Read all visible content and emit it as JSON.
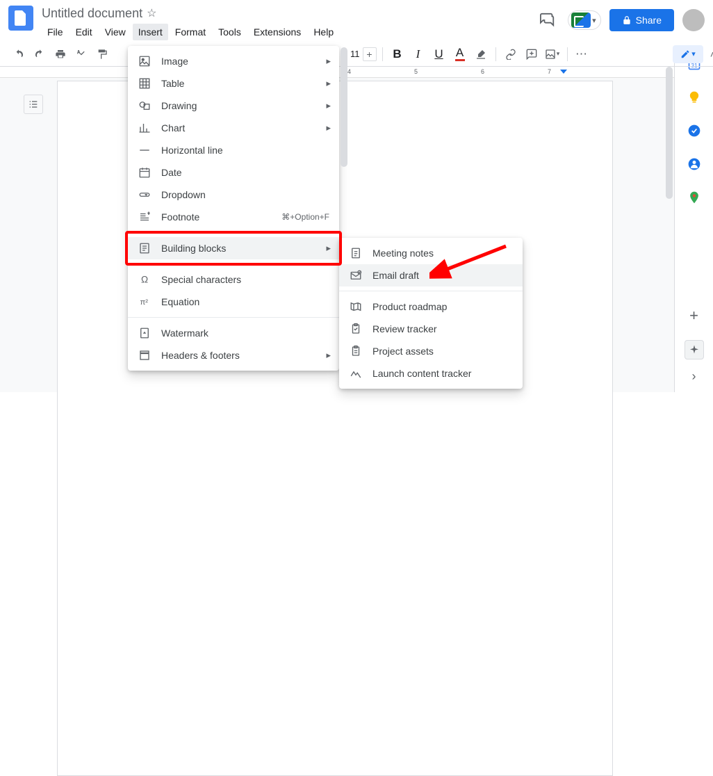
{
  "doc_title": "Untitled document",
  "menubar": [
    "File",
    "Edit",
    "View",
    "Insert",
    "Format",
    "Tools",
    "Extensions",
    "Help"
  ],
  "active_menu_index": 3,
  "share_label": "Share",
  "toolbar": {
    "zoom": "11",
    "font_size_plus": "+",
    "font_size_minus": "−",
    "bold": "B",
    "italic": "I",
    "underline": "U",
    "text_a": "A",
    "more": "⋯"
  },
  "ruler_numbers": [
    "4",
    "5",
    "6",
    "7"
  ],
  "insert_menu": [
    {
      "label": "Image",
      "sub": true,
      "icon": "image"
    },
    {
      "label": "Table",
      "sub": true,
      "icon": "table"
    },
    {
      "label": "Drawing",
      "sub": true,
      "icon": "drawing"
    },
    {
      "label": "Chart",
      "sub": true,
      "icon": "chart"
    },
    {
      "label": "Horizontal line",
      "sub": false,
      "icon": "hline"
    },
    {
      "label": "Date",
      "sub": false,
      "icon": "date"
    },
    {
      "label": "Dropdown",
      "sub": false,
      "icon": "dropdown"
    },
    {
      "label": "Footnote",
      "sub": false,
      "icon": "footnote",
      "shortcut": "⌘+Option+F"
    },
    {
      "sep": true
    },
    {
      "label": "Building blocks",
      "sub": true,
      "icon": "bblocks",
      "hl": true
    },
    {
      "sep": true
    },
    {
      "label": "Special characters",
      "sub": false,
      "icon": "omega"
    },
    {
      "label": "Equation",
      "sub": false,
      "icon": "equation"
    },
    {
      "sep": true
    },
    {
      "label": "Watermark",
      "sub": false,
      "icon": "watermark"
    },
    {
      "label": "Headers & footers",
      "sub": true,
      "icon": "headers"
    }
  ],
  "building_blocks_submenu": [
    {
      "label": "Meeting notes",
      "icon": "notes"
    },
    {
      "label": "Email draft",
      "icon": "email",
      "hover": true,
      "arrow": true
    },
    {
      "sep": true
    },
    {
      "label": "Product roadmap",
      "icon": "roadmap"
    },
    {
      "label": "Review tracker",
      "icon": "review"
    },
    {
      "label": "Project assets",
      "icon": "assets"
    },
    {
      "label": "Launch content tracker",
      "icon": "launch"
    }
  ],
  "sidepanel_icons": [
    "calendar",
    "keep",
    "tasks",
    "contacts",
    "maps"
  ],
  "sidepanel_add": "+"
}
